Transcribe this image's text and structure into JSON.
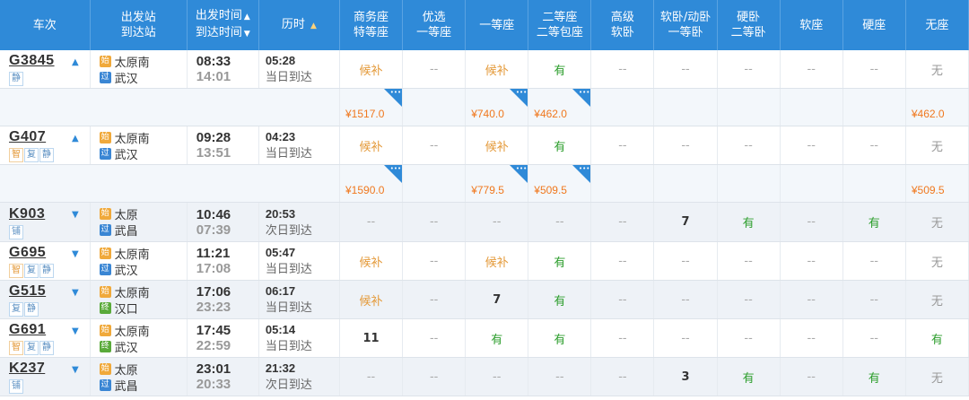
{
  "header": {
    "train": "车次",
    "station_1": "出发站",
    "station_2": "到达站",
    "time_1": "出发时间",
    "time_2": "到达时间",
    "duration": "历时",
    "biz_1": "商务座",
    "biz_2": "特等座",
    "pref_1": "优选",
    "pref_2": "一等座",
    "first": "一等座",
    "second_1": "二等座",
    "second_2": "二等包座",
    "adv_1": "高级",
    "adv_2": "软卧",
    "soft1_1": "软卧/动卧",
    "soft1_2": "一等卧",
    "hard_1": "硬卧",
    "hard_2": "二等卧",
    "softseat": "软座",
    "hardseat": "硬座",
    "noseat": "无座"
  },
  "trains": [
    {
      "no": "G3845",
      "dir": "up",
      "tags": [
        "静"
      ],
      "from": "太原南",
      "from_b": "始",
      "to": "武汉",
      "to_b": "过",
      "dep": "08:33",
      "arr": "14:01",
      "dur": "05:28",
      "day": "当日到达",
      "seats": [
        "候补",
        "--",
        "候补",
        "有",
        "--",
        "--",
        "--",
        "--",
        "--",
        "无"
      ],
      "prices": [
        "¥1517.0",
        "",
        "¥740.0",
        "¥462.0",
        "",
        "",
        "",
        "",
        "",
        "¥462.0"
      ]
    },
    {
      "no": "G407",
      "dir": "up",
      "tags": [
        "智",
        "复",
        "静"
      ],
      "from": "太原南",
      "from_b": "始",
      "to": "武汉",
      "to_b": "过",
      "dep": "09:28",
      "arr": "13:51",
      "dur": "04:23",
      "day": "当日到达",
      "seats": [
        "候补",
        "--",
        "候补",
        "有",
        "--",
        "--",
        "--",
        "--",
        "--",
        "无"
      ],
      "prices": [
        "¥1590.0",
        "",
        "¥779.5",
        "¥509.5",
        "",
        "",
        "",
        "",
        "",
        "¥509.5"
      ]
    },
    {
      "no": "K903",
      "dir": "down",
      "tags": [
        "铺"
      ],
      "from": "太原",
      "from_b": "始",
      "to": "武昌",
      "to_b": "过",
      "dep": "10:46",
      "arr": "07:39",
      "dur": "20:53",
      "day": "次日到达",
      "seats": [
        "--",
        "--",
        "--",
        "--",
        "--",
        "7",
        "有",
        "--",
        "有",
        "无"
      ]
    },
    {
      "no": "G695",
      "dir": "down",
      "tags": [
        "智",
        "复",
        "静"
      ],
      "from": "太原南",
      "from_b": "始",
      "to": "武汉",
      "to_b": "过",
      "dep": "11:21",
      "arr": "17:08",
      "dur": "05:47",
      "day": "当日到达",
      "seats": [
        "候补",
        "--",
        "候补",
        "有",
        "--",
        "--",
        "--",
        "--",
        "--",
        "无"
      ]
    },
    {
      "no": "G515",
      "dir": "down",
      "tags": [
        "复",
        "静"
      ],
      "from": "太原南",
      "from_b": "始",
      "to": "汉口",
      "to_b": "终",
      "dep": "17:06",
      "arr": "23:23",
      "dur": "06:17",
      "day": "当日到达",
      "seats": [
        "候补",
        "--",
        "7",
        "有",
        "--",
        "--",
        "--",
        "--",
        "--",
        "无"
      ]
    },
    {
      "no": "G691",
      "dir": "down",
      "tags": [
        "智",
        "复",
        "静"
      ],
      "from": "太原南",
      "from_b": "始",
      "to": "武汉",
      "to_b": "终",
      "dep": "17:45",
      "arr": "22:59",
      "dur": "05:14",
      "day": "当日到达",
      "seats": [
        "11",
        "--",
        "有",
        "有",
        "--",
        "--",
        "--",
        "--",
        "--",
        "有"
      ]
    },
    {
      "no": "K237",
      "dir": "down",
      "tags": [
        "铺"
      ],
      "from": "太原",
      "from_b": "始",
      "to": "武昌",
      "to_b": "过",
      "dep": "23:01",
      "arr": "20:33",
      "dur": "21:32",
      "day": "次日到达",
      "seats": [
        "--",
        "--",
        "--",
        "--",
        "--",
        "3",
        "有",
        "--",
        "有",
        "无"
      ]
    }
  ],
  "colors": {
    "header_bg": "#2f8ad8",
    "orange": "#e49a3a",
    "green": "#2d9e2d",
    "price": "#f0781e"
  }
}
